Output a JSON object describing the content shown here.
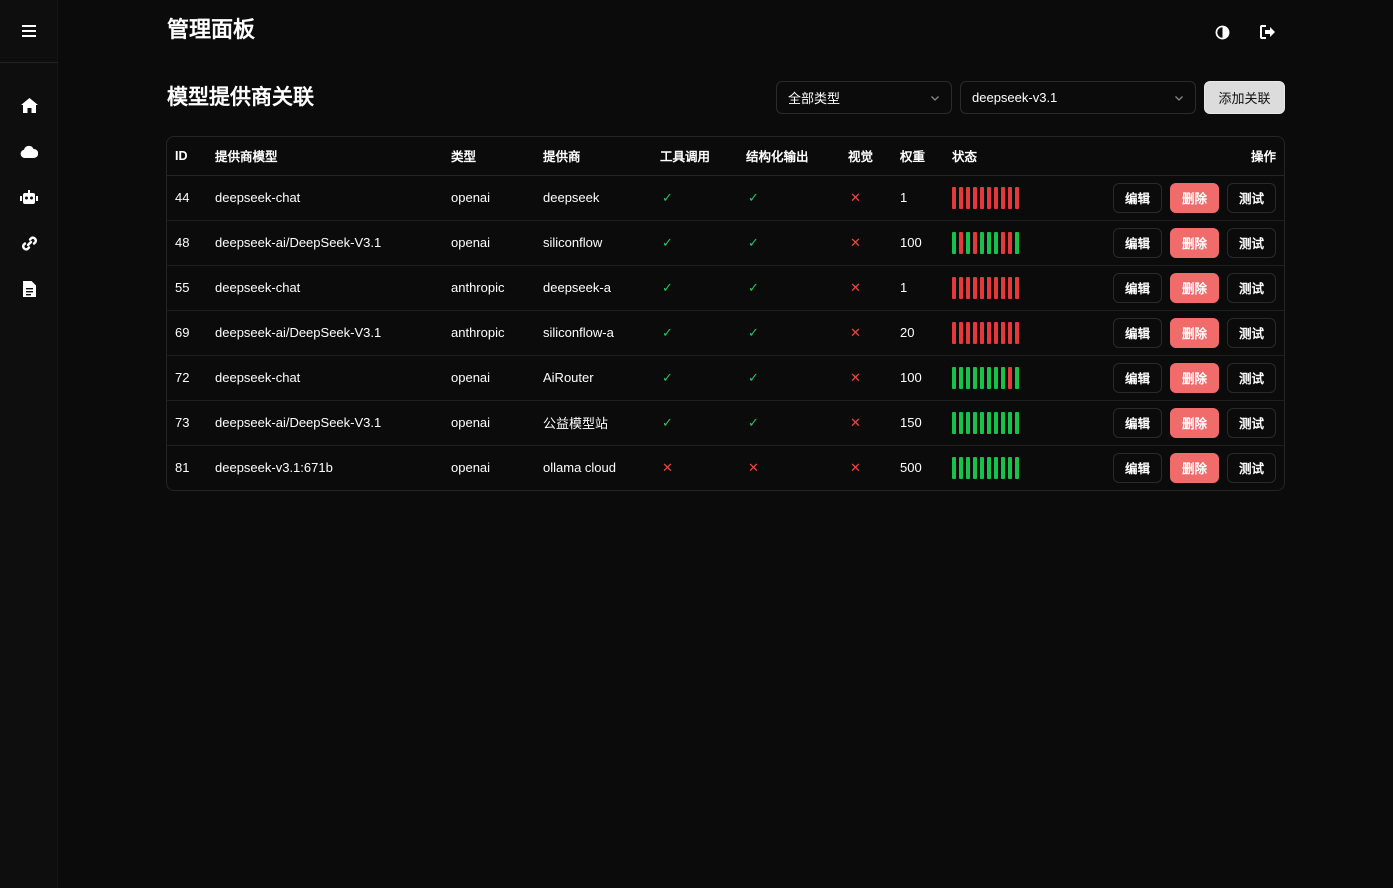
{
  "header": {
    "title": "管理面板"
  },
  "sidebar": {
    "items": [
      {
        "icon": "home-icon"
      },
      {
        "icon": "cloud-icon"
      },
      {
        "icon": "robot-icon"
      },
      {
        "icon": "link-icon"
      },
      {
        "icon": "document-icon"
      }
    ]
  },
  "page": {
    "title": "模型提供商关联",
    "type_filter": "全部类型",
    "model_filter": "deepseek-v3.1",
    "add_label": "添加关联"
  },
  "table": {
    "columns": [
      "ID",
      "提供商模型",
      "类型",
      "提供商",
      "工具调用",
      "结构化输出",
      "视觉",
      "权重",
      "状态",
      "操作"
    ],
    "actions": {
      "edit": "编辑",
      "delete": "删除",
      "test": "测试"
    },
    "rows": [
      {
        "id": "44",
        "model": "deepseek-chat",
        "type": "openai",
        "provider": "deepseek",
        "tool": true,
        "structured": true,
        "vision": false,
        "weight": "1",
        "status": [
          "r",
          "r",
          "r",
          "r",
          "r",
          "r",
          "r",
          "r",
          "r",
          "r"
        ]
      },
      {
        "id": "48",
        "model": "deepseek-ai/DeepSeek-V3.1",
        "type": "openai",
        "provider": "siliconflow",
        "tool": true,
        "structured": true,
        "vision": false,
        "weight": "100",
        "status": [
          "g",
          "r",
          "g",
          "r",
          "g",
          "g",
          "g",
          "r",
          "r",
          "g"
        ]
      },
      {
        "id": "55",
        "model": "deepseek-chat",
        "type": "anthropic",
        "provider": "deepseek-a",
        "tool": true,
        "structured": true,
        "vision": false,
        "weight": "1",
        "status": [
          "r",
          "r",
          "r",
          "r",
          "r",
          "r",
          "r",
          "r",
          "r",
          "r"
        ]
      },
      {
        "id": "69",
        "model": "deepseek-ai/DeepSeek-V3.1",
        "type": "anthropic",
        "provider": "siliconflow-a",
        "tool": true,
        "structured": true,
        "vision": false,
        "weight": "20",
        "status": [
          "r",
          "r",
          "r",
          "r",
          "r",
          "r",
          "r",
          "r",
          "r",
          "r"
        ]
      },
      {
        "id": "72",
        "model": "deepseek-chat",
        "type": "openai",
        "provider": "AiRouter",
        "tool": true,
        "structured": true,
        "vision": false,
        "weight": "100",
        "status": [
          "g",
          "g",
          "g",
          "g",
          "g",
          "g",
          "g",
          "g",
          "r",
          "g"
        ]
      },
      {
        "id": "73",
        "model": "deepseek-ai/DeepSeek-V3.1",
        "type": "openai",
        "provider": "公益模型站",
        "tool": true,
        "structured": true,
        "vision": false,
        "weight": "150",
        "status": [
          "g",
          "g",
          "g",
          "g",
          "g",
          "g",
          "g",
          "g",
          "g",
          "g"
        ]
      },
      {
        "id": "81",
        "model": "deepseek-v3.1:671b",
        "type": "openai",
        "provider": "ollama cloud",
        "tool": false,
        "structured": false,
        "vision": false,
        "weight": "500",
        "status": [
          "g",
          "g",
          "g",
          "g",
          "g",
          "g",
          "g",
          "g",
          "g",
          "g"
        ]
      }
    ]
  },
  "colors": {
    "ok": "#22c55e",
    "fail": "#ef4444",
    "bar_green": "#16c24a",
    "bar_red": "#e5383b",
    "danger_button": "#f26b6b"
  }
}
